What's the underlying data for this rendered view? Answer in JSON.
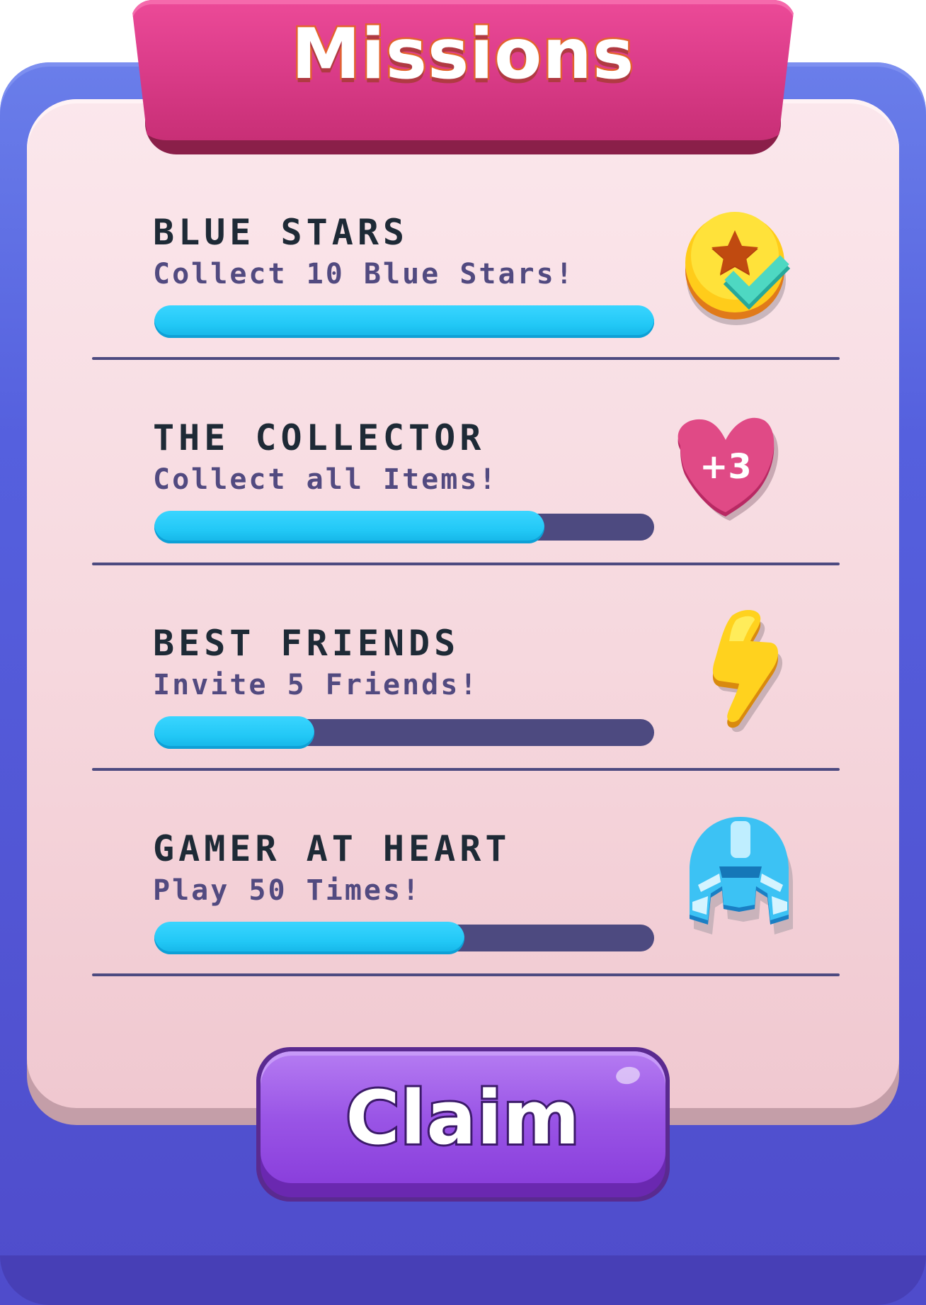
{
  "header": {
    "title": "Missions"
  },
  "missions": [
    {
      "title": "BLUE STARS",
      "description": "Collect 10 Blue Stars!",
      "progress": 1.0,
      "reward_icon": "star-coin-check-icon"
    },
    {
      "title": "THE COLLECTOR",
      "description": "Collect all Items!",
      "progress": 0.78,
      "reward_icon": "heart-bonus-icon",
      "reward_label": "+3"
    },
    {
      "title": "BEST FRIENDS",
      "description": "Invite 5 Friends!",
      "progress": 0.32,
      "reward_icon": "lightning-bolt-icon"
    },
    {
      "title": "GAMER AT HEART",
      "description": "Play 50 Times!",
      "progress": 0.62,
      "reward_icon": "helmet-icon"
    }
  ],
  "footer": {
    "claim_label": "Claim"
  },
  "colors": {
    "frame": "#5560de",
    "card": "#f6d8de",
    "banner": "#dc3d8a",
    "progress_fill": "#22c8f6",
    "progress_track": "#4d4a80",
    "claim_button": "#9a55e6"
  }
}
